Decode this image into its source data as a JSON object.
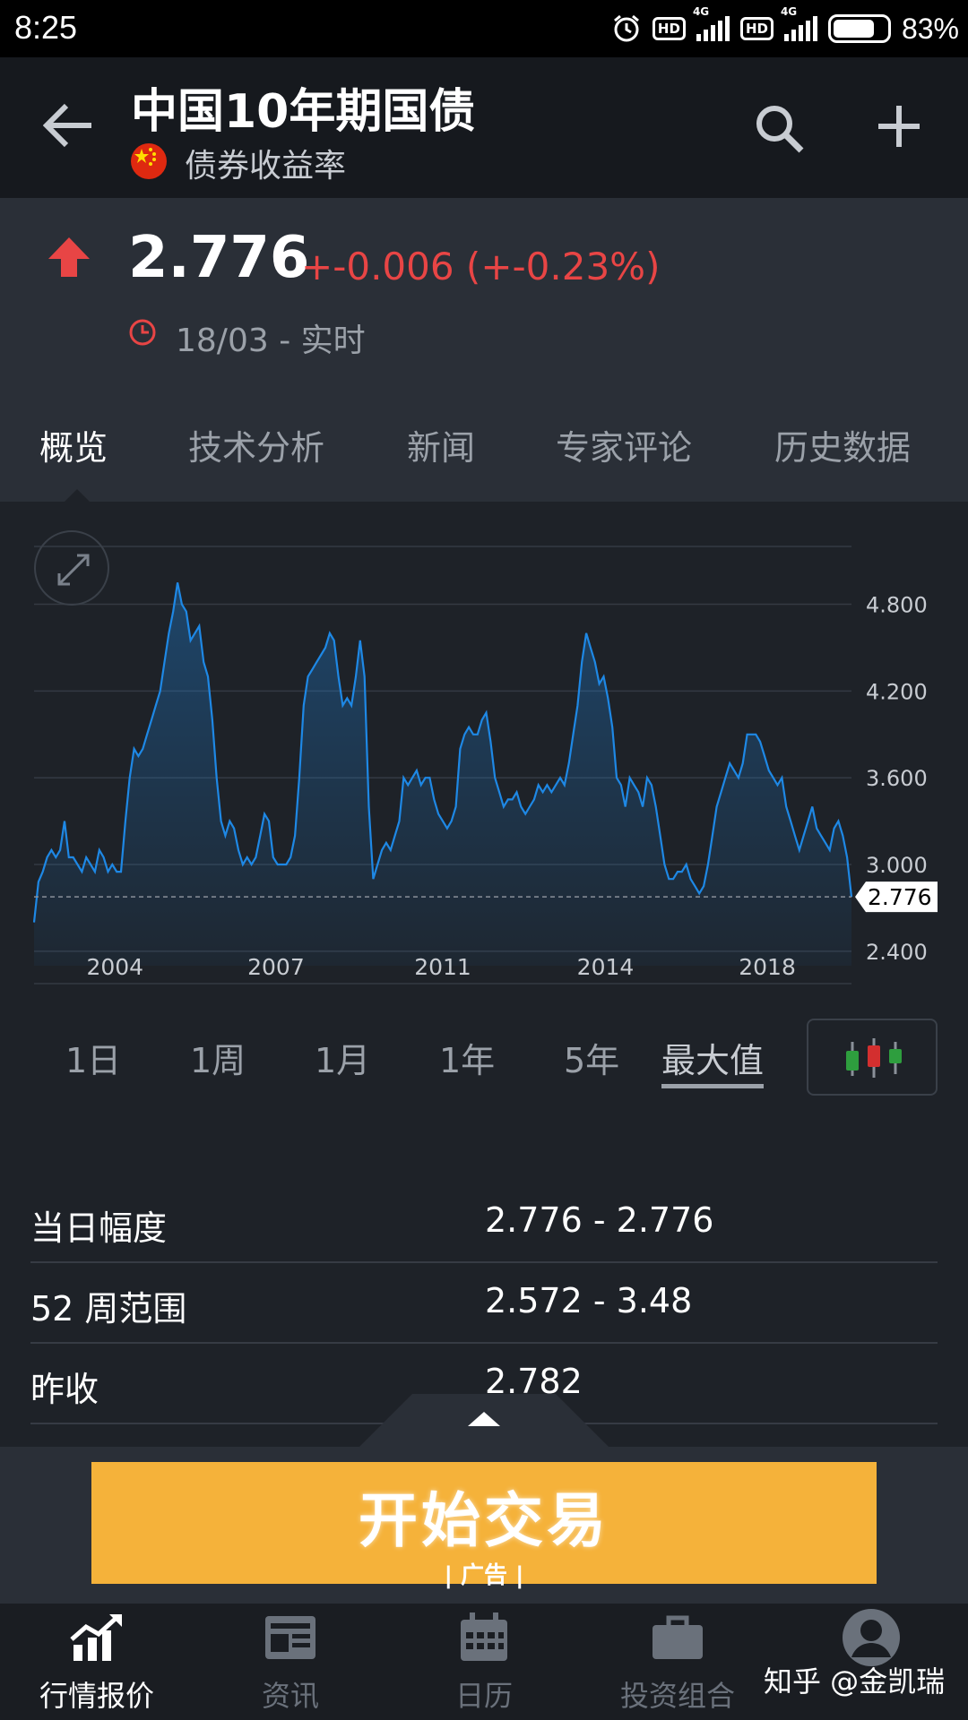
{
  "status_bar": {
    "time": "8:25",
    "hd_badge": "HD",
    "network": "4G",
    "battery": "83%",
    "icons": [
      "alarm-icon",
      "hd-icon",
      "signal-icon",
      "hd-icon",
      "signal-icon",
      "battery-icon"
    ]
  },
  "header": {
    "title": "中国10年期国债",
    "subtitle": "债券收益率",
    "icons": [
      "back-arrow-icon",
      "china-flag-icon",
      "search-icon",
      "plus-icon"
    ]
  },
  "quote": {
    "price": "2.776",
    "change": "+-0.006 (+-0.23%)",
    "as_of": "18/03 - 实时",
    "change_color": "#e84545",
    "icons": [
      "up-arrow-icon",
      "clock-icon"
    ]
  },
  "tabs": [
    {
      "label": "概览",
      "active": true
    },
    {
      "label": "技术分析",
      "active": false
    },
    {
      "label": "新闻",
      "active": false
    },
    {
      "label": "专家评论",
      "active": false
    },
    {
      "label": "历史数据",
      "active": false
    }
  ],
  "chart_data": {
    "type": "area",
    "x_tick_labels": [
      "2004",
      "2007",
      "2011",
      "2014",
      "2018"
    ],
    "y_tick_labels": [
      "4.800",
      "4.200",
      "3.600",
      "3.000",
      "2.400"
    ],
    "ylim": [
      2.3,
      5.2
    ],
    "current_value_label": "2.776",
    "line_color": "#1e88e5",
    "series": [
      {
        "values": [
          2.6,
          2.88,
          2.95,
          3.05,
          3.1,
          3.05,
          3.1,
          3.3,
          3.05,
          3.05,
          3.0,
          2.95,
          3.05,
          3.0,
          2.95,
          3.1,
          3.05,
          2.95,
          3.0,
          2.95,
          2.95,
          3.3,
          3.6,
          3.8,
          3.75,
          3.8,
          3.9,
          4.0,
          4.1,
          4.2,
          4.4,
          4.6,
          4.75,
          4.95,
          4.8,
          4.75,
          4.55,
          4.6,
          4.65,
          4.4,
          4.3,
          4.0,
          3.6,
          3.3,
          3.2,
          3.3,
          3.25,
          3.1,
          3.0,
          3.05,
          3.0,
          3.05,
          3.2,
          3.35,
          3.3,
          3.05,
          3.0,
          3.0,
          3.0,
          3.05,
          3.2,
          3.6,
          4.1,
          4.3,
          4.35,
          4.4,
          4.45,
          4.5,
          4.6,
          4.55,
          4.3,
          4.1,
          4.15,
          4.1,
          4.3,
          4.55,
          4.3,
          3.4,
          2.9,
          3.0,
          3.1,
          3.15,
          3.1,
          3.2,
          3.3,
          3.6,
          3.55,
          3.6,
          3.65,
          3.55,
          3.6,
          3.6,
          3.45,
          3.35,
          3.3,
          3.25,
          3.3,
          3.4,
          3.8,
          3.9,
          3.95,
          3.9,
          3.9,
          4.0,
          4.05,
          3.85,
          3.6,
          3.5,
          3.4,
          3.45,
          3.45,
          3.5,
          3.4,
          3.35,
          3.4,
          3.45,
          3.55,
          3.5,
          3.55,
          3.5,
          3.55,
          3.6,
          3.55,
          3.7,
          3.9,
          4.1,
          4.4,
          4.6,
          4.5,
          4.4,
          4.25,
          4.3,
          4.15,
          3.95,
          3.6,
          3.55,
          3.4,
          3.6,
          3.55,
          3.5,
          3.4,
          3.6,
          3.55,
          3.4,
          3.2,
          3.0,
          2.9,
          2.9,
          2.95,
          2.95,
          3.0,
          2.9,
          2.85,
          2.8,
          2.85,
          3.0,
          3.2,
          3.4,
          3.5,
          3.6,
          3.7,
          3.65,
          3.6,
          3.7,
          3.9,
          3.9,
          3.9,
          3.85,
          3.75,
          3.65,
          3.6,
          3.55,
          3.6,
          3.4,
          3.3,
          3.2,
          3.1,
          3.2,
          3.3,
          3.4,
          3.25,
          3.2,
          3.15,
          3.1,
          3.25,
          3.3,
          3.2,
          3.05,
          2.776
        ]
      }
    ]
  },
  "ranges": [
    {
      "label": "1日",
      "active": false
    },
    {
      "label": "1周",
      "active": false
    },
    {
      "label": "1月",
      "active": false
    },
    {
      "label": "1年",
      "active": false
    },
    {
      "label": "5年",
      "active": false
    },
    {
      "label": "最大值",
      "active": true
    }
  ],
  "candlestick_button_icon": "candlestick-icon",
  "expand_icon": "expand-icon",
  "stats": [
    {
      "label": "当日幅度",
      "value": "2.776 - 2.776"
    },
    {
      "label": "52 周范围",
      "value": "2.572 - 3.48"
    },
    {
      "label": "昨收",
      "value": "2.782"
    }
  ],
  "ad": {
    "title": "开始交易",
    "tag": "| 广告 |",
    "color": "#f5b23a"
  },
  "bottom_nav": [
    {
      "label": "行情报价",
      "icon": "market-chart-icon",
      "active": true
    },
    {
      "label": "资讯",
      "icon": "news-icon",
      "active": false
    },
    {
      "label": "日历",
      "icon": "calendar-icon",
      "active": false
    },
    {
      "label": "投资组合",
      "icon": "briefcase-icon",
      "active": false
    },
    {
      "label": "",
      "icon": "profile-icon",
      "active": false
    }
  ],
  "watermark": "知乎 @金凯瑞"
}
